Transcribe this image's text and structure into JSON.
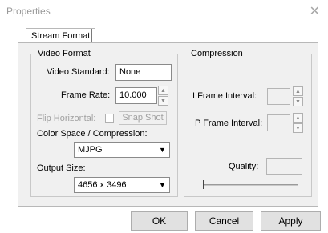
{
  "window": {
    "title": "Properties",
    "close_glyph": "✕"
  },
  "tabs": [
    {
      "label": "Stream Format",
      "active": true
    }
  ],
  "video_format": {
    "legend": "Video Format",
    "video_standard": {
      "label": "Video Standard:",
      "value": "None"
    },
    "frame_rate": {
      "label": "Frame Rate:",
      "value": "10.000"
    },
    "flip_horizontal": {
      "label": "Flip Horizontal:",
      "checked": false,
      "enabled": false
    },
    "snap_shot": {
      "label": "Snap Shot",
      "enabled": false
    },
    "color_space": {
      "label": "Color Space / Compression:",
      "value": "MJPG"
    },
    "output_size": {
      "label": "Output Size:",
      "value": "4656 x 3496"
    }
  },
  "compression": {
    "legend": "Compression",
    "i_frame_interval": {
      "label": "I Frame Interval:",
      "value": ""
    },
    "p_frame_interval": {
      "label": "P Frame Interval:",
      "value": ""
    },
    "quality": {
      "label": "Quality:",
      "value": ""
    }
  },
  "buttons": {
    "ok": "OK",
    "cancel": "Cancel",
    "apply": "Apply"
  },
  "glyphs": {
    "spin_up": "▲",
    "spin_down": "▼",
    "dropdown": "▼"
  }
}
